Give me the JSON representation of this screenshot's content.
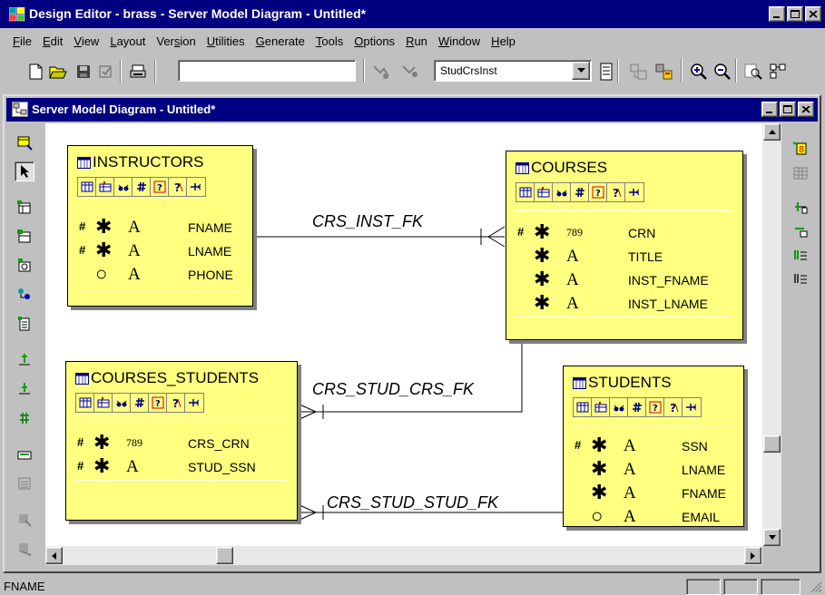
{
  "app": {
    "title": "Design Editor - brass - Server Model Diagram - Untitled*"
  },
  "menu": [
    {
      "label": "File",
      "underline": "F",
      "rest": "ile"
    },
    {
      "label": "Edit",
      "underline": "E",
      "rest": "dit"
    },
    {
      "label": "View",
      "underline": "V",
      "rest": "iew"
    },
    {
      "label": "Layout",
      "underline": "L",
      "rest": "ayout"
    },
    {
      "label": "Version",
      "pre": "Ver",
      "underline": "s",
      "rest": "ion"
    },
    {
      "label": "Utilities",
      "underline": "U",
      "rest": "tilities"
    },
    {
      "label": "Generate",
      "underline": "G",
      "rest": "enerate"
    },
    {
      "label": "Tools",
      "underline": "T",
      "rest": "ools"
    },
    {
      "label": "Options",
      "underline": "O",
      "rest": "ptions"
    },
    {
      "label": "Run",
      "underline": "R",
      "rest": "un"
    },
    {
      "label": "Window",
      "underline": "W",
      "rest": "indow"
    },
    {
      "label": "Help",
      "underline": "H",
      "rest": "elp"
    }
  ],
  "toolbar": {
    "search_value": "",
    "container_value": "StudCrsInst"
  },
  "diagram_window": {
    "title": "Server Model Diagram - Untitled*"
  },
  "entities": {
    "instructors": {
      "name": "INSTRUCTORS",
      "columns": [
        {
          "key": "#",
          "mandatory": "✱",
          "type": "A",
          "name": "FNAME"
        },
        {
          "key": "#",
          "mandatory": "✱",
          "type": "A",
          "name": "LNAME"
        },
        {
          "key": "",
          "mandatory": "○",
          "type": "A",
          "name": "PHONE"
        }
      ]
    },
    "courses": {
      "name": "COURSES",
      "columns": [
        {
          "key": "#",
          "mandatory": "✱",
          "type": "789",
          "name": "CRN"
        },
        {
          "key": "",
          "mandatory": "✱",
          "type": "A",
          "name": "TITLE"
        },
        {
          "key": "",
          "mandatory": "✱",
          "type": "A",
          "name": "INST_FNAME"
        },
        {
          "key": "",
          "mandatory": "✱",
          "type": "A",
          "name": "INST_LNAME"
        }
      ]
    },
    "courses_students": {
      "name": "COURSES_STUDENTS",
      "columns": [
        {
          "key": "#",
          "mandatory": "✱",
          "type": "789",
          "name": "CRS_CRN"
        },
        {
          "key": "#",
          "mandatory": "✱",
          "type": "A",
          "name": "STUD_SSN"
        }
      ]
    },
    "students": {
      "name": "STUDENTS",
      "columns": [
        {
          "key": "#",
          "mandatory": "✱",
          "type": "A",
          "name": "SSN"
        },
        {
          "key": "",
          "mandatory": "✱",
          "type": "A",
          "name": "LNAME"
        },
        {
          "key": "",
          "mandatory": "✱",
          "type": "A",
          "name": "FNAME"
        },
        {
          "key": "",
          "mandatory": "○",
          "type": "A",
          "name": "EMAIL"
        }
      ]
    }
  },
  "foreign_keys": {
    "crs_inst": "CRS_INST_FK",
    "crs_stud_crs": "CRS_STUD_CRS_FK",
    "crs_stud_stud": "CRS_STUD_STUD_FK"
  },
  "status": {
    "text": "FNAME"
  },
  "colors": {
    "titlebar": "#000080",
    "entity_fill": "#ffff80",
    "chrome": "#c0c0c0"
  }
}
